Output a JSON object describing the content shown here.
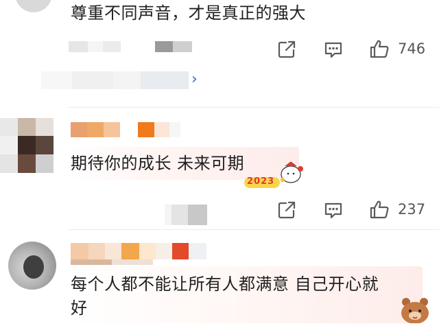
{
  "comments": [
    {
      "text": "尊重不同声音，才是真正的强大",
      "likes": "746",
      "reply_chevron": "›"
    },
    {
      "text": "期待你的成长 未来可期",
      "emoji_sticker": "2023",
      "likes": "237"
    },
    {
      "text_line1": "每个人都不能让所有人都满意 自己开心就",
      "text_line2": "好"
    }
  ],
  "colors": {
    "text": "#1f1f1f",
    "icon": "#5a5a5a",
    "divider": "#ececec",
    "link": "#3a6fb0",
    "mosaic_orange": "#f07a2c",
    "mosaic_red": "#e24a2a"
  },
  "icons": {
    "share": "share-icon",
    "comment": "comment-icon",
    "like": "thumbs-up-icon"
  }
}
